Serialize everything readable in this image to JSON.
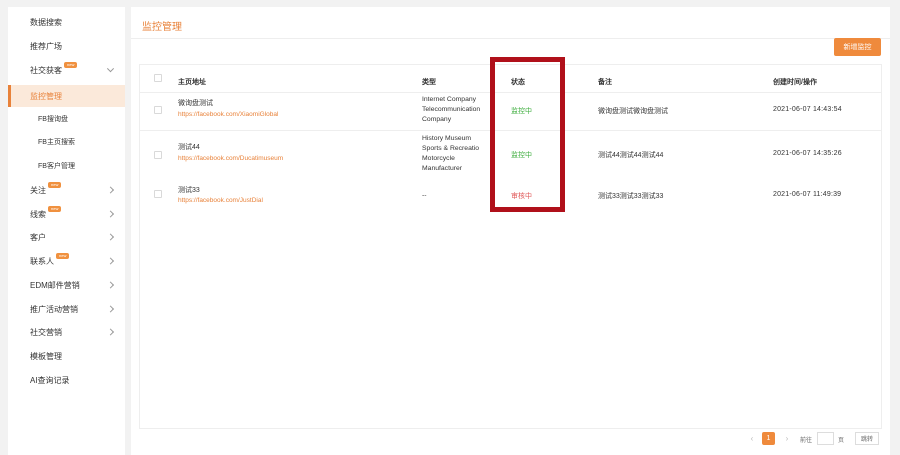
{
  "sidebar": {
    "items": [
      {
        "label": "数据搜索"
      },
      {
        "label": "推荐广场"
      },
      {
        "label": "社交获客",
        "badge": "new"
      },
      {
        "label": "监控管理"
      },
      {
        "label": "FB搜询盘"
      },
      {
        "label": "FB主页搜索"
      },
      {
        "label": "FB客户管理"
      },
      {
        "label": "关注",
        "badge": "new"
      },
      {
        "label": "线索",
        "badge": "new"
      },
      {
        "label": "客户"
      },
      {
        "label": "联系人",
        "badge": "new"
      },
      {
        "label": "EDM邮件营销"
      },
      {
        "label": "推广活动营销"
      },
      {
        "label": "社交营销"
      },
      {
        "label": "模板管理"
      },
      {
        "label": "AI查询记录"
      }
    ]
  },
  "main": {
    "title": "监控管理",
    "add_button": "新增监控",
    "columns": {
      "url": "主页地址",
      "type": "类型",
      "status": "状态",
      "note": "备注",
      "time": "创建时间/操作"
    },
    "rows": [
      {
        "name": "微询盘测试",
        "url": "https://facebook.com/XiaomiGlobal",
        "type": [
          "Internet Company",
          "Telecommunication",
          "Company"
        ],
        "status": "监控中",
        "note": "微询盘测试微询盘测试",
        "time": "2021-06-07 14:43:54"
      },
      {
        "name": "测试44",
        "url": "https://facebook.com/Ducatimuseum",
        "type": [
          "History Museum",
          "Sports & Recreatio",
          "Motorcycle",
          "Manufacturer"
        ],
        "status": "监控中",
        "note": "测试44测试44测试44",
        "time": "2021-06-07 14:35:26"
      },
      {
        "name": "测试33",
        "url": "https://facebook.com/JustDial",
        "type": [
          "--"
        ],
        "status": "审核中",
        "note": "测试33测试33测试33",
        "time": "2021-06-07 11:49:39"
      }
    ]
  },
  "pagination": {
    "prev": "‹",
    "current": "1",
    "next": "›",
    "goto_label": "前往",
    "page_label": "页",
    "go_button": "跳转"
  },
  "colors": {
    "accent": "#ef8a3c",
    "status_active": "#3fae3f",
    "status_pending": "#e05a5a",
    "highlight": "#b0101a"
  }
}
